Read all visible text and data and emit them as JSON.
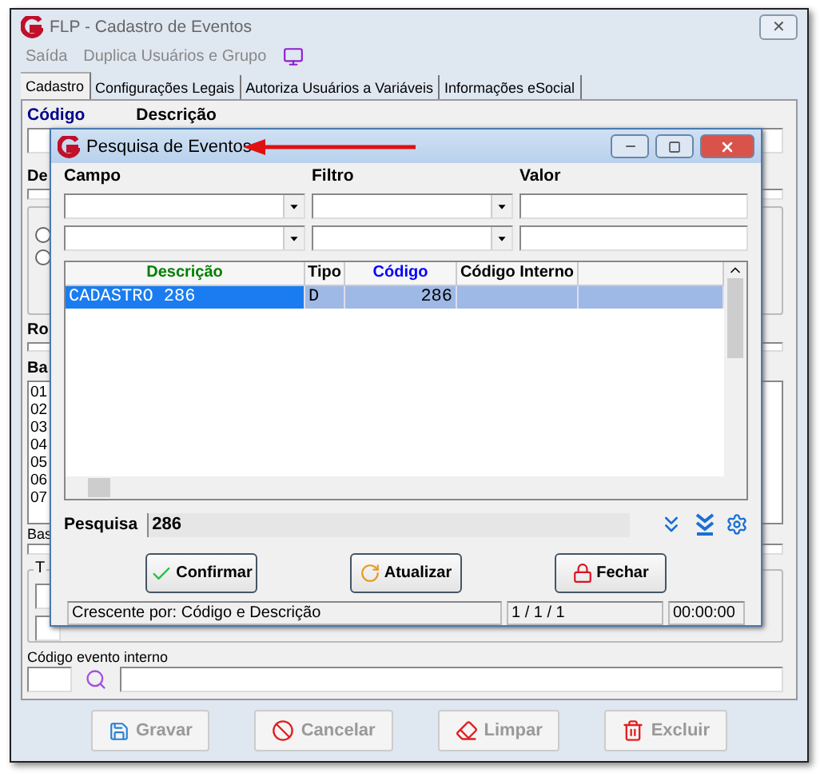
{
  "window": {
    "title": "FLP - Cadastro de Eventos",
    "close": "✕"
  },
  "menu": [
    {
      "label": "Saída"
    },
    {
      "label": "Duplica Usuários e Grupo"
    }
  ],
  "tabs": [
    {
      "label": "Cadastro",
      "selected": true
    },
    {
      "label": "Configurações Legais",
      "selected": false
    },
    {
      "label": "Autoriza Usuários a Variáveis",
      "selected": false
    },
    {
      "label": "Informações eSocial",
      "selected": false
    }
  ],
  "form": {
    "radios": [
      {
        "checked": false
      },
      {
        "checked": false
      }
    ],
    "code_label": "Código",
    "description_label": "Descrição",
    "label_2": "De",
    "label_3": "Ro",
    "label_4": "Ba",
    "list_items": [
      "01",
      "02",
      "03",
      "04",
      "05",
      "06",
      "07"
    ],
    "label_5": "Bas",
    "group_label": "T",
    "internal_code_label": "Código evento interno"
  },
  "dialog": {
    "title": "Pesquisa de Eventos",
    "filter_labels": [
      "Campo",
      "Filtro",
      "Valor"
    ],
    "columns": [
      {
        "label": "Descrição",
        "color": "#008000"
      },
      {
        "label": "Tipo",
        "color": "#000000"
      },
      {
        "label": "Código",
        "color": "#0000ff"
      },
      {
        "label": "Código Interno",
        "color": "#000000"
      }
    ],
    "rows": [
      {
        "cells": [
          "CADASTRO 286",
          "D",
          "286",
          ""
        ],
        "selected": true
      }
    ],
    "search_label": "Pesquisa",
    "search_value": "286",
    "buttons": [
      {
        "kind": "confirm",
        "label": "Confirmar"
      },
      {
        "kind": "refresh",
        "label": "Atualizar"
      },
      {
        "kind": "close",
        "label": "Fechar"
      }
    ],
    "status": [
      "Crescente por: Código e Descrição",
      "1 / 1 / 1",
      "00:00:00"
    ]
  },
  "actions": [
    {
      "kind": "save",
      "label": "Gravar",
      "disabled": true
    },
    {
      "kind": "cancel",
      "label": "Cancelar",
      "disabled": true
    },
    {
      "kind": "clear",
      "label": "Limpar",
      "disabled": true
    },
    {
      "kind": "delete",
      "label": "Excluir",
      "disabled": true
    }
  ]
}
